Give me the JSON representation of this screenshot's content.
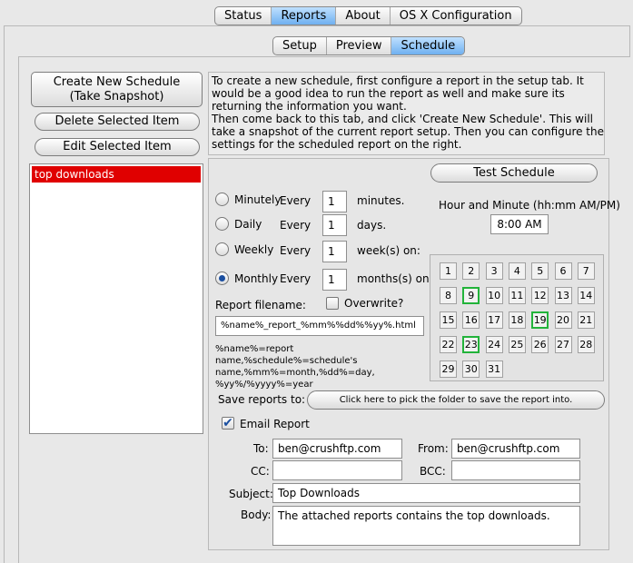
{
  "top_tabs": [
    "Status",
    "Reports",
    "About",
    "OS X Configuration"
  ],
  "top_selected": "Reports",
  "sub_tabs": [
    "Setup",
    "Preview",
    "Schedule"
  ],
  "sub_selected": "Schedule",
  "buttons": {
    "create_line1": "Create New Schedule",
    "create_line2": "(Take Snapshot)",
    "delete": "Delete Selected Item",
    "edit": "Edit Selected Item",
    "test": "Test Schedule",
    "pick_folder": "Click here to pick the folder to save the report into."
  },
  "schedule_list": [
    "top downloads"
  ],
  "instructions": "To create a new schedule, first configure a report in the setup tab. It would be a good idea to run the report as well and make sure its returning the information you want.\nThen come back to this tab, and click 'Create New Schedule'. This will take a snapshot of the current report setup. Then you can configure the settings for the scheduled report on the right.",
  "frequency": {
    "every_label": "Every",
    "rows": [
      {
        "name": "Minutely",
        "value": "1",
        "unit": "minutes.",
        "selected": false
      },
      {
        "name": "Daily",
        "value": "1",
        "unit": "days.",
        "selected": false
      },
      {
        "name": "Weekly",
        "value": "1",
        "unit": "week(s) on:",
        "selected": false
      },
      {
        "name": "Monthly",
        "value": "1",
        "unit": "months(s) on:",
        "selected": true
      }
    ]
  },
  "time": {
    "label": "Hour and Minute (hh:mm AM/PM)",
    "value": "8:00 AM"
  },
  "days": {
    "count": 31,
    "selected": [
      9,
      19,
      23
    ]
  },
  "report_filename": {
    "label": "Report filename:",
    "overwrite_label": "Overwrite?",
    "overwrite_checked": false,
    "value": "%name%_report_%mm%%dd%%yy%.html",
    "help": "%name%=report name,%schedule%=schedule's name,%mm%=month,%dd%=day, %yy%/%yyyy%=year"
  },
  "save_reports_label": "Save reports to:",
  "email": {
    "checkbox_label": "Email Report",
    "checked": true,
    "to_label": "To:",
    "to": "ben@crushftp.com",
    "from_label": "From:",
    "from": "ben@crushftp.com",
    "cc_label": "CC:",
    "cc": "",
    "bcc_label": "BCC:",
    "bcc": "",
    "subject_label": "Subject:",
    "subject": "Top Downloads",
    "body_label": "Body:",
    "body": "The attached reports contains the top downloads."
  },
  "colors": {
    "selection": "#e00000",
    "tab_selected": "#79b6f2",
    "day_selected": "#22b33a"
  }
}
